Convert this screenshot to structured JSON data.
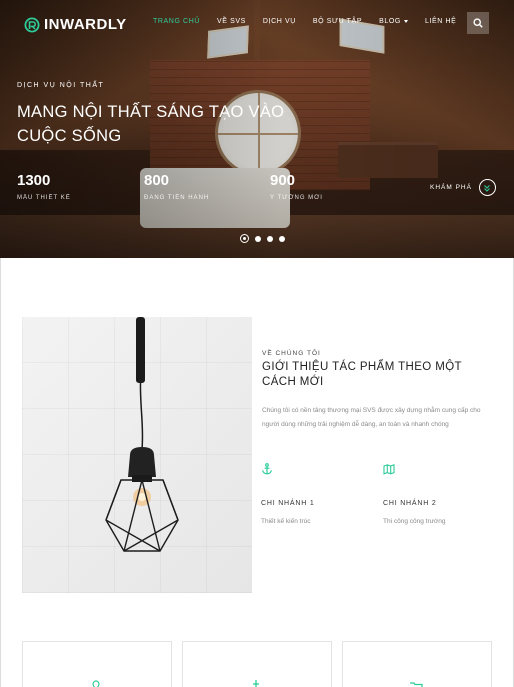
{
  "brand": {
    "name": "INWARDLY",
    "accent": "#2ecc9a"
  },
  "nav": {
    "items": [
      {
        "label": "TRANG CHỦ",
        "active": true
      },
      {
        "label": "VỀ SVS",
        "active": false
      },
      {
        "label": "DỊCH VỤ",
        "active": false
      },
      {
        "label": "BỘ SƯU TẬP",
        "active": false
      },
      {
        "label": "BLOG",
        "active": false,
        "dropdown": true
      },
      {
        "label": "LIÊN HỆ",
        "active": false
      }
    ],
    "search_icon": "search-icon"
  },
  "hero": {
    "eyebrow": "DỊCH VỤ NỘI THẤT",
    "title": "MANG NỘI THẤT SÁNG TẠO VÀO CUỘC SỐNG",
    "stats": [
      {
        "value": "1300",
        "label": "MẪU THIẾT KẾ"
      },
      {
        "value": "800",
        "label": "ĐANG TIẾN HÀNH"
      },
      {
        "value": "900",
        "label": "Ý TƯỞNG MỚI"
      }
    ],
    "explore_label": "KHÁM PHÁ",
    "slides": {
      "count": 4,
      "active": 1
    }
  },
  "about": {
    "eyebrow": "VỀ CHÚNG TÔI",
    "title": "GIỚI THIỆU TÁC PHẨM THEO MỘT CÁCH MỚI",
    "description": "Chúng tôi có nền tảng thương mại SVS được xây dựng nhằm cung cấp cho người dùng những trải nghiệm dễ dàng, an toàn và nhanh chóng",
    "branches": [
      {
        "icon": "anchor-icon",
        "title": "CHI NHÁNH 1",
        "desc": "Thiết kế kiến trúc"
      },
      {
        "icon": "map-icon",
        "title": "CHI NHÁNH 2",
        "desc": "Thi công công trường"
      }
    ]
  },
  "cards": [
    {
      "icon": "location-icon"
    },
    {
      "icon": "anchor-icon"
    },
    {
      "icon": "folder-icon"
    }
  ]
}
